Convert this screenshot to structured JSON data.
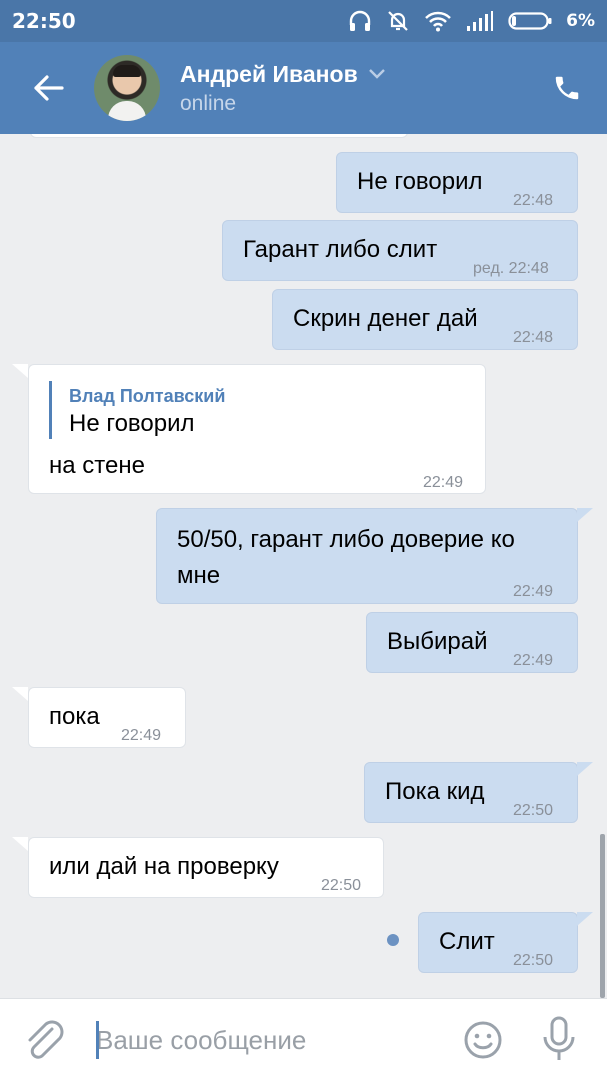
{
  "status_bar": {
    "time": "22:50",
    "battery": "6%"
  },
  "header": {
    "name": "Андрей Иванов",
    "status": "online"
  },
  "messages": [
    {
      "dir": "out",
      "text": "Не говорил",
      "time": "22:48"
    },
    {
      "dir": "out",
      "text": "Гарант либо слит",
      "time": "ред. 22:48"
    },
    {
      "dir": "out",
      "text": "Скрин денег дай",
      "time": "22:48"
    },
    {
      "dir": "in",
      "reply_author": "Влад Полтавский",
      "reply_text": "Не говорил",
      "text": "на стене",
      "time": "22:49"
    },
    {
      "dir": "out",
      "text_line1": "50/50, гарант либо доверие ко",
      "text_line2": "мне",
      "time": "22:49"
    },
    {
      "dir": "out",
      "text": "Выбирай",
      "time": "22:49"
    },
    {
      "dir": "in",
      "text": "пока",
      "time": "22:49"
    },
    {
      "dir": "out",
      "text": "Пока кид",
      "time": "22:50"
    },
    {
      "dir": "in",
      "text": "или дай на проверку",
      "time": "22:50"
    },
    {
      "dir": "out",
      "text": "Слит",
      "time": "22:50",
      "unread": true
    }
  ],
  "composer": {
    "placeholder": "Ваше сообщение"
  },
  "colors": {
    "header": "#5181b8",
    "statusbar": "#4a76a8",
    "outgoing": "#cbdcf0",
    "incoming": "#ffffff",
    "background": "#edeef0"
  },
  "icons": [
    "arrow-left-icon",
    "chevron-down-icon",
    "phone-icon",
    "paperclip-icon",
    "smiley-icon",
    "microphone-icon",
    "headphones-icon",
    "bell-off-icon",
    "wifi-icon",
    "signal-icon",
    "battery-icon"
  ]
}
